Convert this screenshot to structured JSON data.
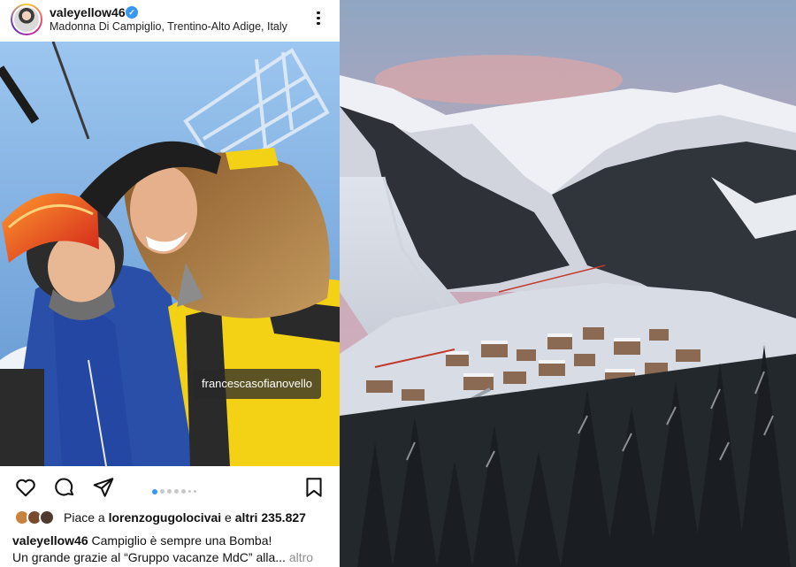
{
  "post": {
    "username": "valeyellow46",
    "location": "Madonna Di Campiglio, Trentino-Alto Adige, Italy",
    "photo_tag": "francescasofianovello",
    "carousel": {
      "current": 1,
      "total": 7
    },
    "likes": {
      "prefix": "Piace a ",
      "liked_by": "lorenzogugolocivai",
      "connector": " e ",
      "others": "altri 235.827"
    },
    "caption": {
      "username": "valeyellow46",
      "line1": " Campiglio è sempre una Bomba!",
      "line2": "Un grande grazie al “Gruppo vacanze MdC” alla...",
      "more": " altro"
    }
  },
  "icons": {
    "verified": "verified-badge-icon",
    "more": "more-options-icon",
    "like": "heart-icon",
    "comment": "comment-icon",
    "share": "paper-plane-icon",
    "save": "bookmark-icon",
    "user_tags": "user-tag-icon"
  },
  "colors": {
    "verified": "#3897f0",
    "carousel_active": "#3897f0",
    "muted_text": "#8e8e8e"
  }
}
